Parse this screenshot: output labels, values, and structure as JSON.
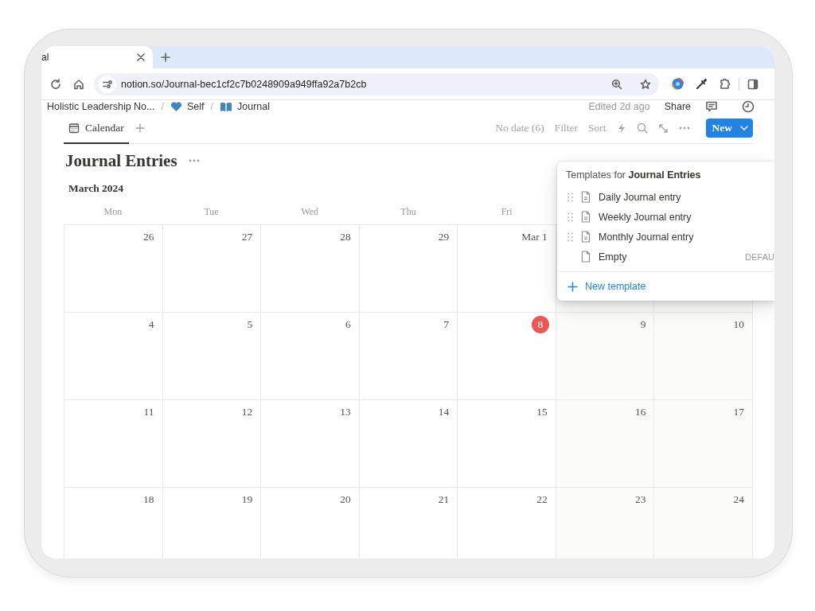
{
  "browser": {
    "tab_title": "al",
    "url": "notion.so/Journal-bec1cf2c7b0248909a949ffa92a7b2cb"
  },
  "header": {
    "breadcrumb": [
      {
        "kind": "text",
        "label": "Holistic Leadership No..."
      },
      {
        "kind": "separator",
        "label": "/"
      },
      {
        "kind": "heart",
        "label": "Self"
      },
      {
        "kind": "separator",
        "label": "/"
      },
      {
        "kind": "book",
        "label": "Journal"
      }
    ],
    "edited": "Edited 2d ago",
    "share": "Share"
  },
  "view_tabs": [
    {
      "label": "Calendar",
      "selected": true
    }
  ],
  "toolbar": {
    "no_date": "No date (6)",
    "filter": "Filter",
    "sort": "Sort",
    "new_button": "New"
  },
  "title": "Journal Entries",
  "month": "March 2024",
  "weekdays": [
    "Mon",
    "Tue",
    "Wed",
    "Thu",
    "Fri"
  ],
  "weeks": [
    {
      "days": [
        {
          "day": "26",
          "today": false
        },
        {
          "day": "27",
          "today": false
        },
        {
          "day": "28",
          "today": false
        },
        {
          "day": "29",
          "today": false
        },
        {
          "day": "Mar 1",
          "today": false
        }
      ]
    },
    {
      "days": [
        {
          "day": "4",
          "today": false
        },
        {
          "day": "5",
          "today": false
        },
        {
          "day": "6",
          "today": false
        },
        {
          "day": "7",
          "today": false
        },
        {
          "day": "8",
          "today": true
        },
        {
          "day": "9",
          "today": false
        },
        {
          "day": "10",
          "today": false
        }
      ]
    },
    {
      "days": [
        {
          "day": "11",
          "today": false
        },
        {
          "day": "12",
          "today": false
        },
        {
          "day": "13",
          "today": false
        },
        {
          "day": "14",
          "today": false
        },
        {
          "day": "15",
          "today": false
        },
        {
          "day": "16",
          "today": false
        },
        {
          "day": "17",
          "today": false
        }
      ]
    },
    {
      "days": [
        {
          "day": "18",
          "today": false
        },
        {
          "day": "19",
          "today": false
        },
        {
          "day": "20",
          "today": false
        },
        {
          "day": "21",
          "today": false
        },
        {
          "day": "22",
          "today": false
        },
        {
          "day": "23",
          "today": false
        },
        {
          "day": "24",
          "today": false
        }
      ]
    }
  ],
  "templates": {
    "heading": "Templates for **Journal Entries**",
    "items": [
      {
        "label": "Daily Journal entry",
        "draggable": true
      },
      {
        "label": "Weekly Journal entry",
        "draggable": true
      },
      {
        "label": "Monthly Journal entry",
        "draggable": true
      },
      {
        "label": "Empty",
        "draggable": false,
        "badge": "DEFAU"
      }
    ],
    "new_template": "New template"
  }
}
